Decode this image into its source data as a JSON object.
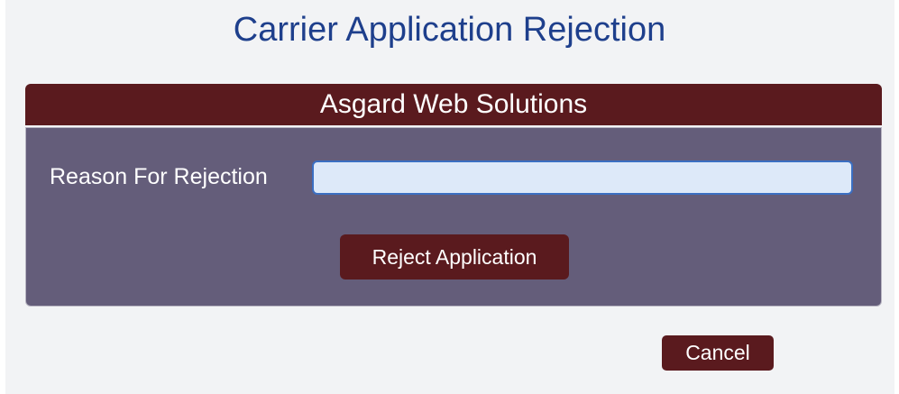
{
  "page": {
    "title": "Carrier Application Rejection"
  },
  "company": {
    "name": "Asgard Web Solutions"
  },
  "form": {
    "reason_label": "Reason For Rejection",
    "reason_value": "",
    "reject_label": "Reject Application"
  },
  "footer": {
    "cancel_label": "Cancel"
  },
  "colors": {
    "title": "#1e3f8c",
    "brand_maroon": "#5a1a1e",
    "panel": "#645d7a",
    "input_bg": "#dde9f9",
    "input_border": "#3b6fc2",
    "page_bg": "#f2f3f5"
  }
}
